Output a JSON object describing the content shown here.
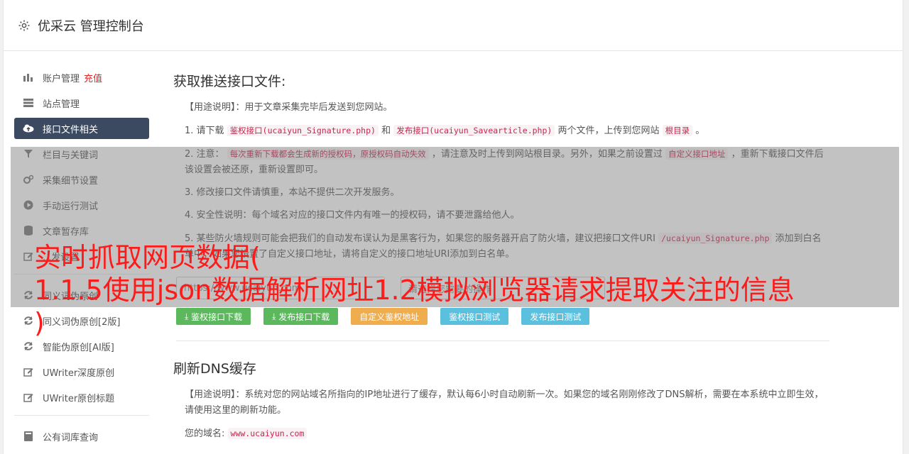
{
  "header": {
    "title": "优采云 管理控制台",
    "icon": "gear-icon"
  },
  "sidebar": {
    "items": [
      {
        "label": "账户管理",
        "extra": "充值",
        "icon": "bar-chart-icon"
      },
      {
        "label": "站点管理",
        "icon": "server-icon"
      },
      {
        "label": "接口文件相关",
        "icon": "cloud-upload-icon",
        "active": true
      },
      {
        "label": "栏目与关键词",
        "icon": "filter-icon"
      },
      {
        "label": "采集细节设置",
        "icon": "cogs-icon"
      },
      {
        "label": "手动运行测试",
        "icon": "play-circle-icon"
      },
      {
        "label": "文章暂存库",
        "icon": "database-icon"
      },
      {
        "label": "...发设置",
        "icon": "edit-icon"
      },
      {
        "label": "同义词伪原创",
        "icon": "refresh-icon"
      },
      {
        "label": "同义词伪原创[2版]",
        "icon": "refresh-icon"
      },
      {
        "label": "智能伪原创[AI版]",
        "icon": "refresh-icon"
      },
      {
        "label": "UWriter深度原创",
        "icon": "edit-icon"
      },
      {
        "label": "UWriter原创标题",
        "icon": "edit-icon"
      },
      {
        "label": "公有词库查询",
        "icon": "book-icon"
      }
    ]
  },
  "section1": {
    "title": "获取推送接口文件:",
    "usage_label": "【用途说明】",
    "usage_text": "：用于文章采集完毕后发送到您网站。",
    "line1": {
      "a": "1. 请下载",
      "code1": "鉴权接口(ucaiyun_Signature.php)",
      "b": "和",
      "code2": "发布接口(ucaiyun_Savearticle.php)",
      "c": "两个文件，上传到您网站",
      "code3": "根目录",
      "d": "。"
    },
    "line2": {
      "a": "2. 注意：",
      "code1": "每次重新下载都会生成新的授权码，原授权码自动失效",
      "b": "，请注意及时上传到网站根目录。另外，如果之前设置过",
      "code2": "自定义接口地址",
      "c": "，重新下载接口文件后该设置会被还原，重新设置即可。"
    },
    "line3": "3. 修改接口文件请慎重，本站不提供二次开发服务。",
    "line4": "4. 安全性说明：每个域名对应的接口文件内有唯一的授权码，请不要泄露给他人。",
    "line5": {
      "a": "5. 某些防火墙规则可能会把我们的自动发布误认为是黑客行为，如果您的服务器开启了防火墙，建议把接口文件URI",
      "code1": "/ucaiyun_Signature.php",
      "b": "添加到白名单中；如果您设置了自定义接口地址，请将自定义的接口地址URI添加到白名单。"
    },
    "select_protocol": "https://www.ucaiyun.com",
    "select_action": "请选择您需要的操作",
    "buttons": [
      "鉴权接口下载",
      "发布接口下载",
      "自定义鉴权地址",
      "鉴权接口测试",
      "发布接口测试"
    ]
  },
  "section2": {
    "title": "刷新DNS缓存",
    "usage_label": "【用途说明】",
    "usage_text": "：系统对您的网站域名所指向的IP地址进行了缓存，默认每6小时自动刷新一次。如果您的域名刚刚修改了DNS解析，需要在本系统中立即生效，请使用这里的刷新功能。",
    "domain_label": "您的域名:",
    "domain_value": "www.ucaiyun.com"
  },
  "watermark": {
    "line1": "实时抓取网页数据(",
    "line2": "1.1.5使用json数据解析网址1.2模拟浏览器请求提取关注的信息",
    "line3": ")"
  },
  "colors": {
    "active_nav": "#3c4a61",
    "btn_green": "#5cb85c",
    "btn_orange": "#f0ad4e",
    "btn_blue": "#5bc0de",
    "watermark": "#ff1a1a"
  }
}
